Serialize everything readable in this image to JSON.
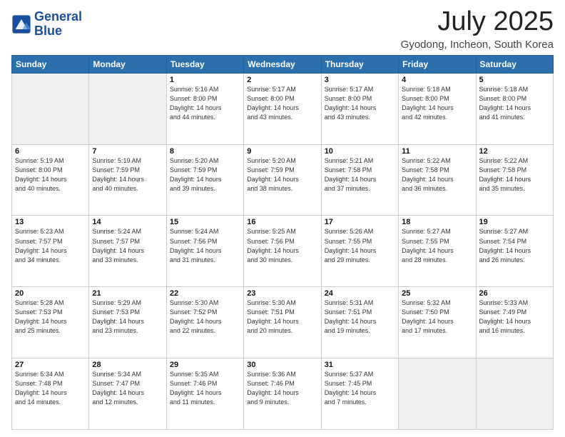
{
  "header": {
    "logo_line1": "General",
    "logo_line2": "Blue",
    "title": "July 2025",
    "subtitle": "Gyodong, Incheon, South Korea"
  },
  "weekdays": [
    "Sunday",
    "Monday",
    "Tuesday",
    "Wednesday",
    "Thursday",
    "Friday",
    "Saturday"
  ],
  "weeks": [
    [
      {
        "day": "",
        "info": ""
      },
      {
        "day": "",
        "info": ""
      },
      {
        "day": "1",
        "info": "Sunrise: 5:16 AM\nSunset: 8:00 PM\nDaylight: 14 hours\nand 44 minutes."
      },
      {
        "day": "2",
        "info": "Sunrise: 5:17 AM\nSunset: 8:00 PM\nDaylight: 14 hours\nand 43 minutes."
      },
      {
        "day": "3",
        "info": "Sunrise: 5:17 AM\nSunset: 8:00 PM\nDaylight: 14 hours\nand 43 minutes."
      },
      {
        "day": "4",
        "info": "Sunrise: 5:18 AM\nSunset: 8:00 PM\nDaylight: 14 hours\nand 42 minutes."
      },
      {
        "day": "5",
        "info": "Sunrise: 5:18 AM\nSunset: 8:00 PM\nDaylight: 14 hours\nand 41 minutes."
      }
    ],
    [
      {
        "day": "6",
        "info": "Sunrise: 5:19 AM\nSunset: 8:00 PM\nDaylight: 14 hours\nand 40 minutes."
      },
      {
        "day": "7",
        "info": "Sunrise: 5:19 AM\nSunset: 7:59 PM\nDaylight: 14 hours\nand 40 minutes."
      },
      {
        "day": "8",
        "info": "Sunrise: 5:20 AM\nSunset: 7:59 PM\nDaylight: 14 hours\nand 39 minutes."
      },
      {
        "day": "9",
        "info": "Sunrise: 5:20 AM\nSunset: 7:59 PM\nDaylight: 14 hours\nand 38 minutes."
      },
      {
        "day": "10",
        "info": "Sunrise: 5:21 AM\nSunset: 7:58 PM\nDaylight: 14 hours\nand 37 minutes."
      },
      {
        "day": "11",
        "info": "Sunrise: 5:22 AM\nSunset: 7:58 PM\nDaylight: 14 hours\nand 36 minutes."
      },
      {
        "day": "12",
        "info": "Sunrise: 5:22 AM\nSunset: 7:58 PM\nDaylight: 14 hours\nand 35 minutes."
      }
    ],
    [
      {
        "day": "13",
        "info": "Sunrise: 5:23 AM\nSunset: 7:57 PM\nDaylight: 14 hours\nand 34 minutes."
      },
      {
        "day": "14",
        "info": "Sunrise: 5:24 AM\nSunset: 7:57 PM\nDaylight: 14 hours\nand 33 minutes."
      },
      {
        "day": "15",
        "info": "Sunrise: 5:24 AM\nSunset: 7:56 PM\nDaylight: 14 hours\nand 31 minutes."
      },
      {
        "day": "16",
        "info": "Sunrise: 5:25 AM\nSunset: 7:56 PM\nDaylight: 14 hours\nand 30 minutes."
      },
      {
        "day": "17",
        "info": "Sunrise: 5:26 AM\nSunset: 7:55 PM\nDaylight: 14 hours\nand 29 minutes."
      },
      {
        "day": "18",
        "info": "Sunrise: 5:27 AM\nSunset: 7:55 PM\nDaylight: 14 hours\nand 28 minutes."
      },
      {
        "day": "19",
        "info": "Sunrise: 5:27 AM\nSunset: 7:54 PM\nDaylight: 14 hours\nand 26 minutes."
      }
    ],
    [
      {
        "day": "20",
        "info": "Sunrise: 5:28 AM\nSunset: 7:53 PM\nDaylight: 14 hours\nand 25 minutes."
      },
      {
        "day": "21",
        "info": "Sunrise: 5:29 AM\nSunset: 7:53 PM\nDaylight: 14 hours\nand 23 minutes."
      },
      {
        "day": "22",
        "info": "Sunrise: 5:30 AM\nSunset: 7:52 PM\nDaylight: 14 hours\nand 22 minutes."
      },
      {
        "day": "23",
        "info": "Sunrise: 5:30 AM\nSunset: 7:51 PM\nDaylight: 14 hours\nand 20 minutes."
      },
      {
        "day": "24",
        "info": "Sunrise: 5:31 AM\nSunset: 7:51 PM\nDaylight: 14 hours\nand 19 minutes."
      },
      {
        "day": "25",
        "info": "Sunrise: 5:32 AM\nSunset: 7:50 PM\nDaylight: 14 hours\nand 17 minutes."
      },
      {
        "day": "26",
        "info": "Sunrise: 5:33 AM\nSunset: 7:49 PM\nDaylight: 14 hours\nand 16 minutes."
      }
    ],
    [
      {
        "day": "27",
        "info": "Sunrise: 5:34 AM\nSunset: 7:48 PM\nDaylight: 14 hours\nand 14 minutes."
      },
      {
        "day": "28",
        "info": "Sunrise: 5:34 AM\nSunset: 7:47 PM\nDaylight: 14 hours\nand 12 minutes."
      },
      {
        "day": "29",
        "info": "Sunrise: 5:35 AM\nSunset: 7:46 PM\nDaylight: 14 hours\nand 11 minutes."
      },
      {
        "day": "30",
        "info": "Sunrise: 5:36 AM\nSunset: 7:46 PM\nDaylight: 14 hours\nand 9 minutes."
      },
      {
        "day": "31",
        "info": "Sunrise: 5:37 AM\nSunset: 7:45 PM\nDaylight: 14 hours\nand 7 minutes."
      },
      {
        "day": "",
        "info": ""
      },
      {
        "day": "",
        "info": ""
      }
    ]
  ]
}
